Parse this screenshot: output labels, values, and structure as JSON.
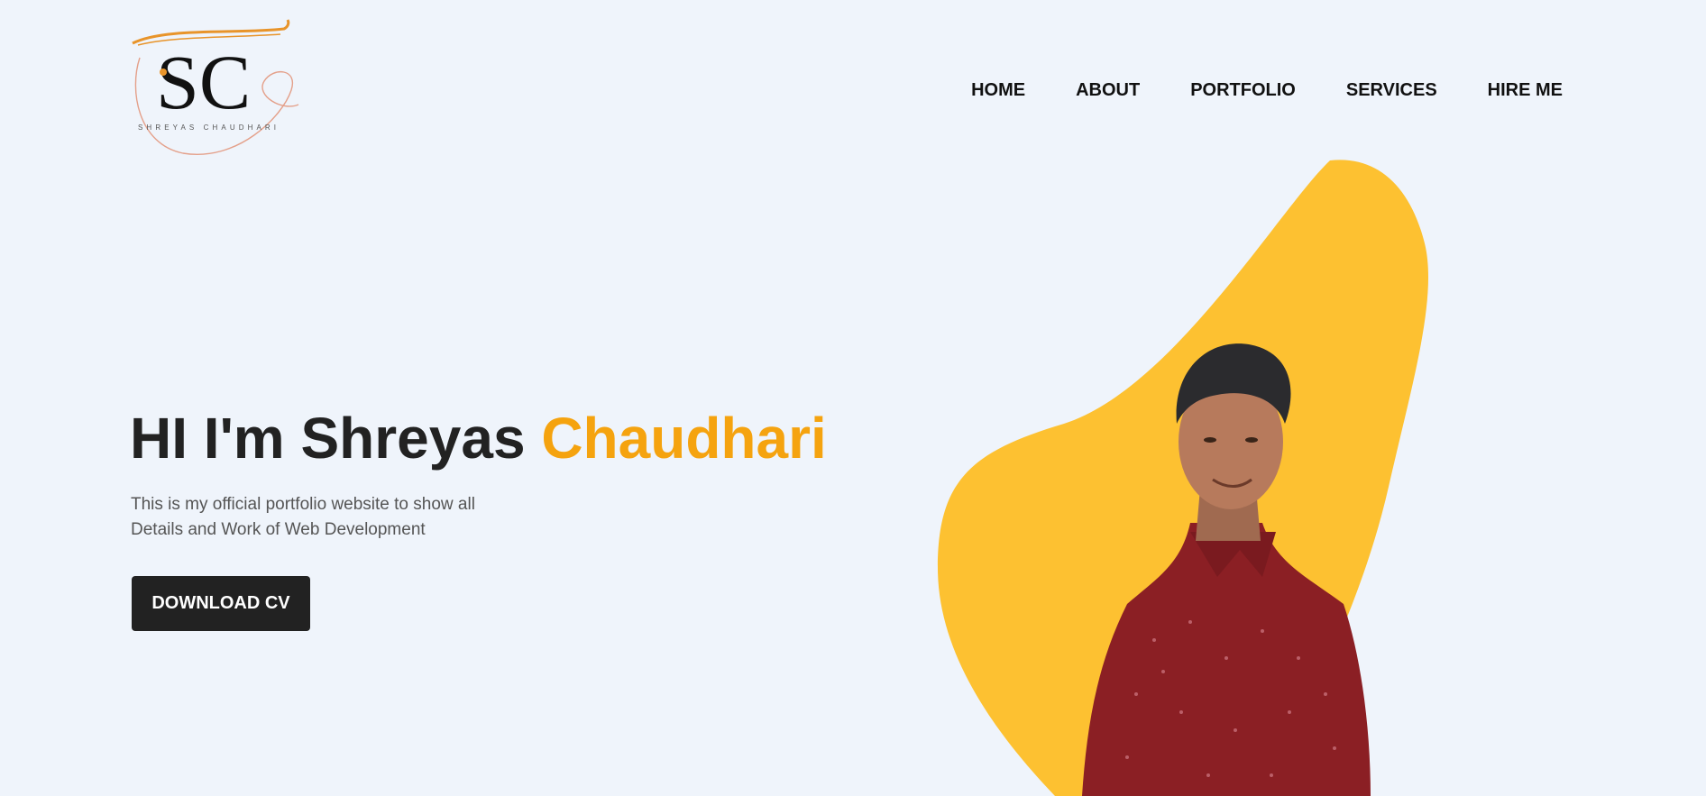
{
  "logo": {
    "monogram": "SC",
    "caption": "SHREYAS CHAUDHARI"
  },
  "nav": {
    "items": [
      {
        "label": "HOME"
      },
      {
        "label": "ABOUT"
      },
      {
        "label": "PORTFOLIO"
      },
      {
        "label": "SERVICES"
      },
      {
        "label": "HIRE ME"
      }
    ]
  },
  "hero": {
    "title_prefix": "HI I'm Shreyas ",
    "title_accent": "Chaudhari",
    "description_line1": "This is my official portfolio website to show all",
    "description_line2": "Details and Work of Web Development",
    "cta_label": "DOWNLOAD CV"
  },
  "colors": {
    "background": "#eff4fb",
    "accent": "#f5a30f",
    "blob": "#fdc131",
    "button": "#222222",
    "shirt": "#8b1f24"
  },
  "icons": {
    "logo": "sc-monogram-logo",
    "profile": "profile-photo"
  }
}
